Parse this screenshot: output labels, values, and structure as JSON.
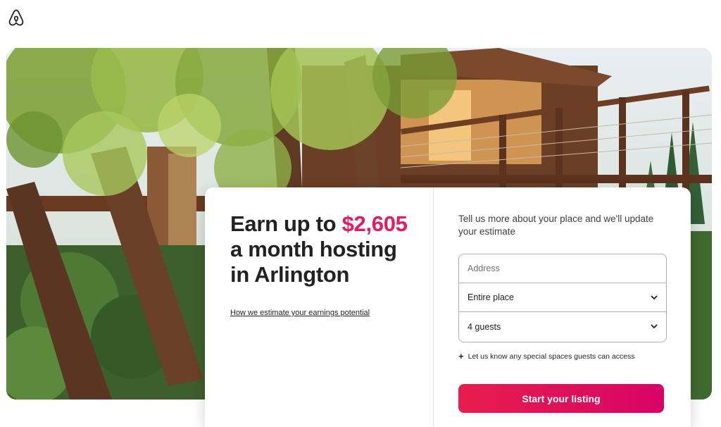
{
  "brand": {
    "logo_icon": "airbnb-logo-icon",
    "color": "#222222"
  },
  "hero": {
    "image_alt": "treehouse with wooden deck among trees"
  },
  "headline": {
    "prefix": "Earn up to ",
    "amount": "$2,605",
    "suffix_line1": "a month hosting",
    "suffix_line2": "in Arlington",
    "amount_color": "#e31c5f"
  },
  "estimate_link": "How we estimate your earnings potential",
  "form": {
    "prompt": "Tell us more about your place and we'll update your estimate",
    "address_placeholder": "Address",
    "place_type_value": "Entire place",
    "guests_value": "4 guests",
    "special_spaces": "Let us know any special spaces guests can access"
  },
  "cta": {
    "label": "Start your listing",
    "color": "#e61e4d"
  }
}
